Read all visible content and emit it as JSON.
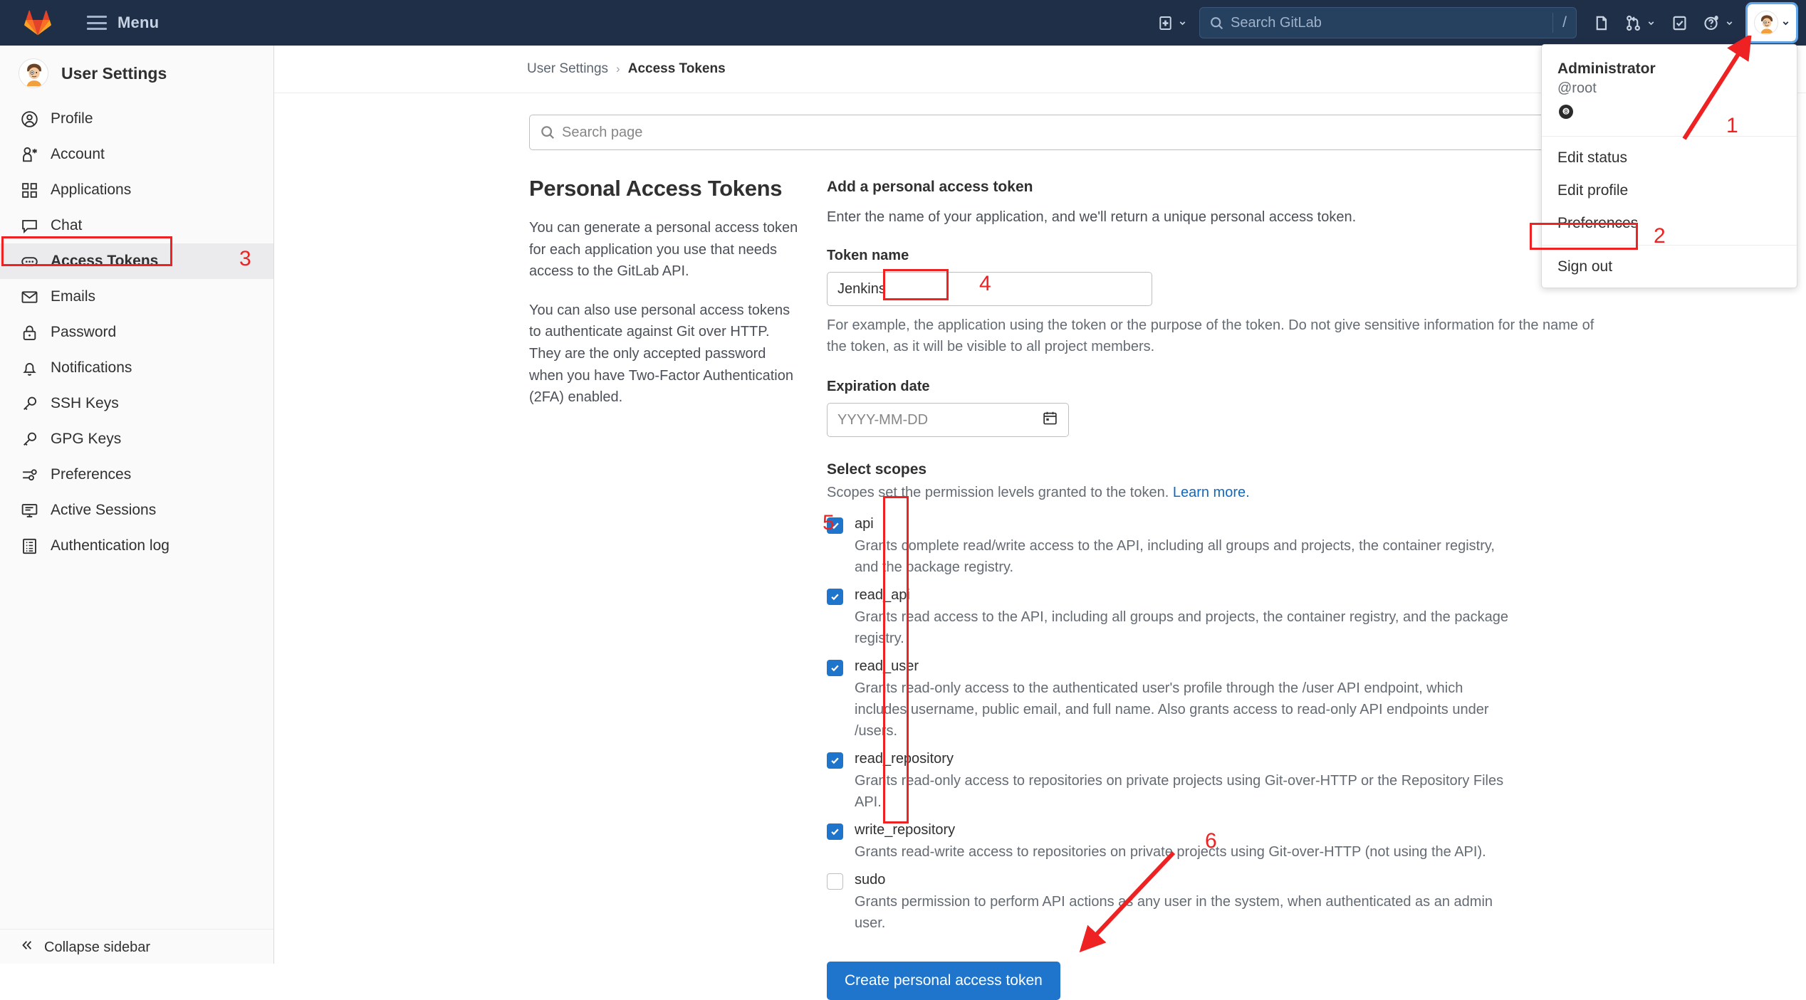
{
  "topnav": {
    "logo_icon": "gitlab-fox-logo",
    "menu_label": "Menu",
    "create_icon": "plus-square-icon",
    "search_placeholder": "Search GitLab",
    "search_shortcut": "/",
    "issues_icon": "issues-icon",
    "merge_requests_icon": "merge-request-icon",
    "todos_icon": "todo-check-icon",
    "help_icon": "help-question-icon",
    "avatar_icon": "user-avatar"
  },
  "user_dropdown": {
    "name": "Administrator",
    "handle": "@root",
    "status_emoji": "8ball-status-icon",
    "items": [
      {
        "label": "Edit status"
      },
      {
        "label": "Edit profile"
      },
      {
        "label": "Preferences"
      },
      {
        "label": "Sign out"
      }
    ]
  },
  "sidebar": {
    "title": "User Settings",
    "items": [
      {
        "label": "Profile",
        "icon": "user-circle-icon",
        "active": false
      },
      {
        "label": "Account",
        "icon": "account-icon",
        "active": false
      },
      {
        "label": "Applications",
        "icon": "grid-apps-icon",
        "active": false
      },
      {
        "label": "Chat",
        "icon": "chat-bubble-icon",
        "active": false
      },
      {
        "label": "Access Tokens",
        "icon": "token-icon",
        "active": true
      },
      {
        "label": "Emails",
        "icon": "envelope-icon",
        "active": false
      },
      {
        "label": "Password",
        "icon": "lock-icon",
        "active": false
      },
      {
        "label": "Notifications",
        "icon": "bell-icon",
        "active": false
      },
      {
        "label": "SSH Keys",
        "icon": "key-icon",
        "active": false
      },
      {
        "label": "GPG Keys",
        "icon": "key-icon",
        "active": false
      },
      {
        "label": "Preferences",
        "icon": "sliders-icon",
        "active": false
      },
      {
        "label": "Active Sessions",
        "icon": "monitor-icon",
        "active": false
      },
      {
        "label": "Authentication log",
        "icon": "list-log-icon",
        "active": false
      }
    ],
    "collapse_label": "Collapse sidebar",
    "collapse_icon": "double-chevron-left-icon"
  },
  "breadcrumb": {
    "parent": "User Settings",
    "separator": "›",
    "current": "Access Tokens"
  },
  "page_search": {
    "placeholder": "Search page",
    "icon": "search-icon"
  },
  "info": {
    "title": "Personal Access Tokens",
    "paragraph1": "You can generate a personal access token for each application you use that needs access to the GitLab API.",
    "paragraph2": "You can also use personal access tokens to authenticate against Git over HTTP. They are the only accepted password when you have Two-Factor Authentication (2FA) enabled."
  },
  "form": {
    "title": "Add a personal access token",
    "subtitle": "Enter the name of your application, and we'll return a unique personal access token.",
    "token_name_label": "Token name",
    "token_name_value": "Jenkins",
    "token_name_help": "For example, the application using the token or the purpose of the token. Do not give sensitive information for the name of the token, as it will be visible to all project members.",
    "expiration_label": "Expiration date",
    "expiration_placeholder": "YYYY-MM-DD",
    "calendar_icon": "calendar-icon",
    "scopes_title": "Select scopes",
    "scopes_subtitle": "Scopes set the permission levels granted to the token.",
    "scopes_link": "Learn more.",
    "scopes": [
      {
        "name": "api",
        "checked": true,
        "description": "Grants complete read/write access to the API, including all groups and projects, the container registry, and the package registry."
      },
      {
        "name": "read_api",
        "checked": true,
        "description": "Grants read access to the API, including all groups and projects, the container registry, and the package registry."
      },
      {
        "name": "read_user",
        "checked": true,
        "description": "Grants read-only access to the authenticated user's profile through the /user API endpoint, which includes username, public email, and full name. Also grants access to read-only API endpoints under /users."
      },
      {
        "name": "read_repository",
        "checked": true,
        "description": "Grants read-only access to repositories on private projects using Git-over-HTTP or the Repository Files API."
      },
      {
        "name": "write_repository",
        "checked": true,
        "description": "Grants read-write access to repositories on private projects using Git-over-HTTP (not using the API)."
      },
      {
        "name": "sudo",
        "checked": false,
        "description": "Grants permission to perform API actions as any user in the system, when authenticated as an admin user."
      }
    ],
    "submit_label": "Create personal access token"
  },
  "annotations": {
    "n1": "1",
    "n2": "2",
    "n3": "3",
    "n4": "4",
    "n5": "5",
    "n6": "6",
    "color": "#ee2222"
  }
}
